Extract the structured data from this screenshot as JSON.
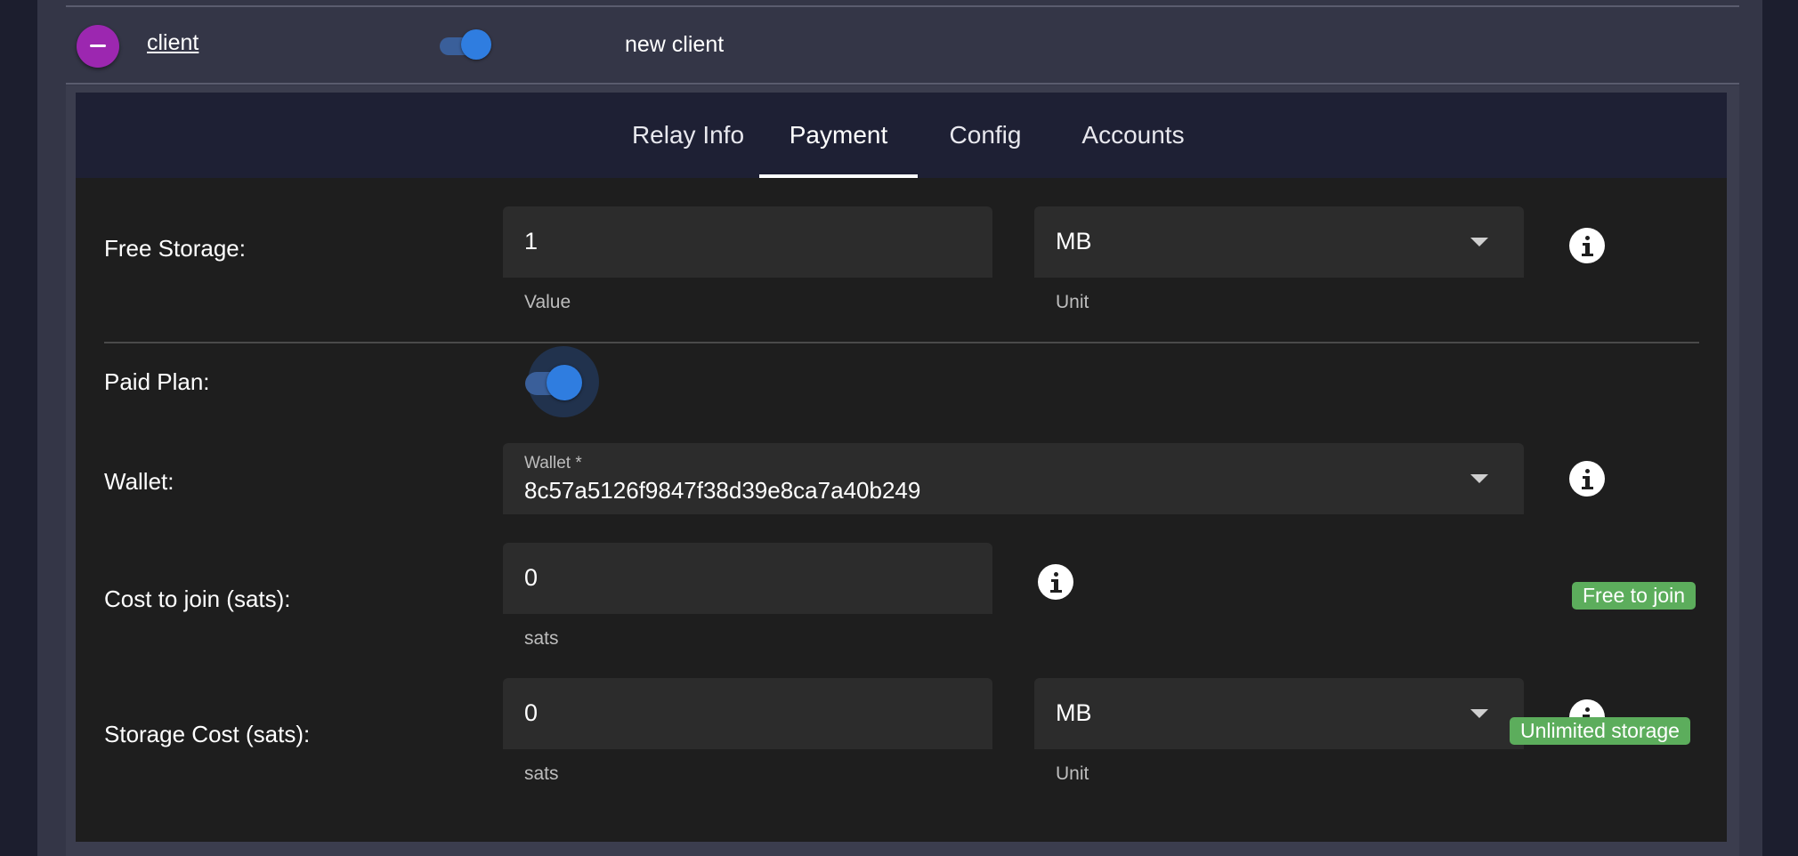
{
  "client": {
    "name": "client",
    "enabled": true,
    "description": "new client"
  },
  "tabs": [
    {
      "label": "Relay Info",
      "active": false
    },
    {
      "label": "Payment",
      "active": true
    },
    {
      "label": "Config",
      "active": false
    },
    {
      "label": "Accounts",
      "active": false
    }
  ],
  "payment": {
    "free_storage": {
      "label": "Free Storage:",
      "value": "1",
      "value_hint": "Value",
      "unit": "MB",
      "unit_hint": "Unit"
    },
    "paid_plan": {
      "label": "Paid Plan:",
      "enabled": true
    },
    "wallet": {
      "label": "Wallet:",
      "field_label": "Wallet *",
      "value": "8c57a5126f9847f38d39e8ca7a40b249"
    },
    "cost_to_join": {
      "label": "Cost to join (sats):",
      "value": "0",
      "hint": "sats",
      "badge": "Free to join"
    },
    "storage_cost": {
      "label": "Storage Cost (sats):",
      "value": "0",
      "hint": "sats",
      "unit": "MB",
      "unit_hint": "Unit",
      "badge": "Unlimited storage"
    }
  },
  "colors": {
    "accent_purple": "#9c27b0",
    "toggle_blue": "#2f7de0",
    "badge_green": "#5cad5c"
  },
  "icons": {
    "remove": "minus-icon",
    "info": "info-icon",
    "dropdown": "caret-down-icon"
  }
}
